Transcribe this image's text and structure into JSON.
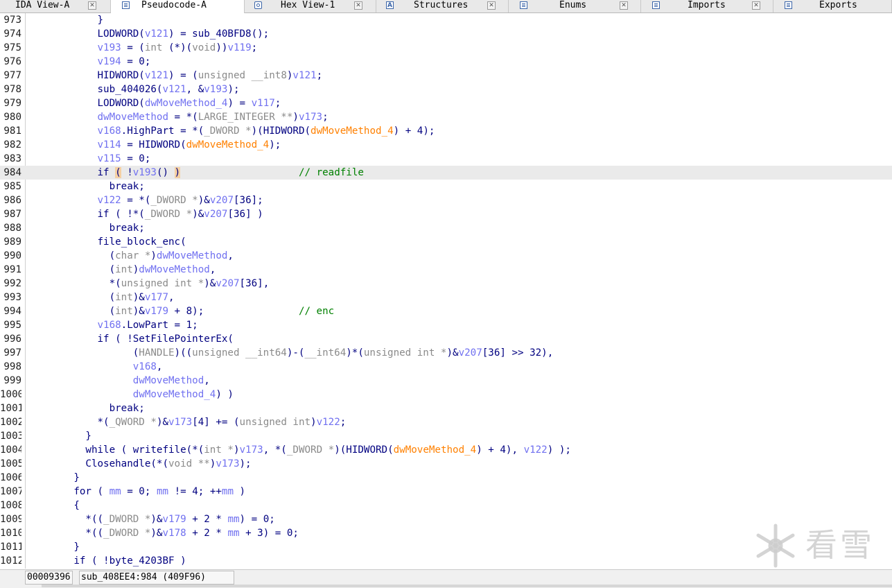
{
  "colors": {
    "keyword": "#000080",
    "variable": "#7070f0",
    "cast": "#8a8a8a",
    "argument": "#ff8000",
    "comment": "#008000",
    "highlight_line": "#eaeaea",
    "paren_match": "#f5d0a3"
  },
  "tabs": [
    {
      "label": "IDA View-A",
      "icon": "doc-icon",
      "active": false
    },
    {
      "label": "Pseudocode-A",
      "icon": "doc-icon",
      "active": true
    },
    {
      "label": "Hex View-1",
      "icon": "hex-icon",
      "active": false
    },
    {
      "label": "Structures",
      "icon": "struct-icon",
      "active": false
    },
    {
      "label": "Enums",
      "icon": "list-icon",
      "active": false
    },
    {
      "label": "Imports",
      "icon": "import-icon",
      "active": false
    },
    {
      "label": "Exports",
      "icon": "export-icon",
      "active": false
    }
  ],
  "tab_close_glyph": "✕",
  "code_lines": [
    {
      "num": "973",
      "tokens": [
        [
          "k",
          "            }"
        ]
      ]
    },
    {
      "num": "974",
      "tokens": [
        [
          "k",
          "            LODWORD("
        ],
        [
          "v",
          "v121"
        ],
        [
          "k",
          ") = sub_40BFD8();"
        ]
      ]
    },
    {
      "num": "975",
      "tokens": [
        [
          "k",
          "            "
        ],
        [
          "v",
          "v193"
        ],
        [
          "k",
          " = ("
        ],
        [
          "c",
          "int"
        ],
        [
          "k",
          " (*)("
        ],
        [
          "c",
          "void"
        ],
        [
          "k",
          "))"
        ],
        [
          "v",
          "v119"
        ],
        [
          "k",
          ";"
        ]
      ]
    },
    {
      "num": "976",
      "tokens": [
        [
          "k",
          "            "
        ],
        [
          "v",
          "v194"
        ],
        [
          "k",
          " = 0;"
        ]
      ]
    },
    {
      "num": "977",
      "tokens": [
        [
          "k",
          "            HIDWORD("
        ],
        [
          "v",
          "v121"
        ],
        [
          "k",
          ") = ("
        ],
        [
          "c",
          "unsigned __int8"
        ],
        [
          "k",
          ")"
        ],
        [
          "v",
          "v121"
        ],
        [
          "k",
          ";"
        ]
      ]
    },
    {
      "num": "978",
      "tokens": [
        [
          "k",
          "            sub_404026("
        ],
        [
          "v",
          "v121"
        ],
        [
          "k",
          ", &"
        ],
        [
          "v",
          "v193"
        ],
        [
          "k",
          ");"
        ]
      ]
    },
    {
      "num": "979",
      "tokens": [
        [
          "k",
          "            LODWORD("
        ],
        [
          "v",
          "dwMoveMethod_4"
        ],
        [
          "k",
          ") = "
        ],
        [
          "v",
          "v117"
        ],
        [
          "k",
          ";"
        ]
      ]
    },
    {
      "num": "980",
      "tokens": [
        [
          "k",
          "            "
        ],
        [
          "v",
          "dwMoveMethod"
        ],
        [
          "k",
          " = *("
        ],
        [
          "c",
          "LARGE_INTEGER **"
        ],
        [
          "k",
          ")"
        ],
        [
          "v",
          "v173"
        ],
        [
          "k",
          ";"
        ]
      ]
    },
    {
      "num": "981",
      "tokens": [
        [
          "k",
          "            "
        ],
        [
          "v",
          "v168"
        ],
        [
          "k",
          ".HighPart = *("
        ],
        [
          "c",
          "_DWORD *"
        ],
        [
          "k",
          ")(HIDWORD("
        ],
        [
          "a",
          "dwMoveMethod_4"
        ],
        [
          "k",
          ") + 4);"
        ]
      ]
    },
    {
      "num": "982",
      "tokens": [
        [
          "k",
          "            "
        ],
        [
          "v",
          "v114"
        ],
        [
          "k",
          " = HIDWORD("
        ],
        [
          "a",
          "dwMoveMethod_4"
        ],
        [
          "k",
          ");"
        ]
      ]
    },
    {
      "num": "983",
      "tokens": [
        [
          "k",
          "            "
        ],
        [
          "v",
          "v115"
        ],
        [
          "k",
          " = 0;"
        ]
      ]
    },
    {
      "num": "984",
      "hl": true,
      "tokens": [
        [
          "k",
          "            if "
        ],
        [
          "p",
          "("
        ],
        [
          "k",
          " !"
        ],
        [
          "v",
          "v193"
        ],
        [
          "k",
          "() "
        ],
        [
          "p",
          ")"
        ],
        [
          "k",
          "                    "
        ],
        [
          "m",
          "// readfile"
        ]
      ]
    },
    {
      "num": "985",
      "tokens": [
        [
          "k",
          "              break;"
        ]
      ]
    },
    {
      "num": "986",
      "tokens": [
        [
          "k",
          "            "
        ],
        [
          "v",
          "v122"
        ],
        [
          "k",
          " = *("
        ],
        [
          "c",
          "_DWORD *"
        ],
        [
          "k",
          ")&"
        ],
        [
          "v",
          "v207"
        ],
        [
          "k",
          "[36];"
        ]
      ]
    },
    {
      "num": "987",
      "tokens": [
        [
          "k",
          "            if ( !*("
        ],
        [
          "c",
          "_DWORD *"
        ],
        [
          "k",
          ")&"
        ],
        [
          "v",
          "v207"
        ],
        [
          "k",
          "[36] )"
        ]
      ]
    },
    {
      "num": "988",
      "tokens": [
        [
          "k",
          "              break;"
        ]
      ]
    },
    {
      "num": "989",
      "tokens": [
        [
          "k",
          "            file_block_enc("
        ]
      ]
    },
    {
      "num": "990",
      "tokens": [
        [
          "k",
          "              ("
        ],
        [
          "c",
          "char *"
        ],
        [
          "k",
          ")"
        ],
        [
          "v",
          "dwMoveMethod"
        ],
        [
          "k",
          ","
        ]
      ]
    },
    {
      "num": "991",
      "tokens": [
        [
          "k",
          "              ("
        ],
        [
          "c",
          "int"
        ],
        [
          "k",
          ")"
        ],
        [
          "v",
          "dwMoveMethod"
        ],
        [
          "k",
          ","
        ]
      ]
    },
    {
      "num": "992",
      "tokens": [
        [
          "k",
          "              *("
        ],
        [
          "c",
          "unsigned int *"
        ],
        [
          "k",
          ")&"
        ],
        [
          "v",
          "v207"
        ],
        [
          "k",
          "[36],"
        ]
      ]
    },
    {
      "num": "993",
      "tokens": [
        [
          "k",
          "              ("
        ],
        [
          "c",
          "int"
        ],
        [
          "k",
          ")&"
        ],
        [
          "v",
          "v177"
        ],
        [
          "k",
          ","
        ]
      ]
    },
    {
      "num": "994",
      "tokens": [
        [
          "k",
          "              ("
        ],
        [
          "c",
          "int"
        ],
        [
          "k",
          ")&"
        ],
        [
          "v",
          "v179"
        ],
        [
          "k",
          " + 8);                "
        ],
        [
          "m",
          "// enc"
        ]
      ]
    },
    {
      "num": "995",
      "tokens": [
        [
          "k",
          "            "
        ],
        [
          "v",
          "v168"
        ],
        [
          "k",
          ".LowPart = 1;"
        ]
      ]
    },
    {
      "num": "996",
      "tokens": [
        [
          "k",
          "            if ( !SetFilePointerEx("
        ]
      ]
    },
    {
      "num": "997",
      "tokens": [
        [
          "k",
          "                  ("
        ],
        [
          "c",
          "HANDLE"
        ],
        [
          "k",
          ")(("
        ],
        [
          "c",
          "unsigned __int64"
        ],
        [
          "k",
          ")-("
        ],
        [
          "c",
          "__int64"
        ],
        [
          "k",
          ")*("
        ],
        [
          "c",
          "unsigned int *"
        ],
        [
          "k",
          ")&"
        ],
        [
          "v",
          "v207"
        ],
        [
          "k",
          "[36] >> 32),"
        ]
      ]
    },
    {
      "num": "998",
      "tokens": [
        [
          "k",
          "                  "
        ],
        [
          "v",
          "v168"
        ],
        [
          "k",
          ","
        ]
      ]
    },
    {
      "num": "999",
      "tokens": [
        [
          "k",
          "                  "
        ],
        [
          "v",
          "dwMoveMethod"
        ],
        [
          "k",
          ","
        ]
      ]
    },
    {
      "num": "1000",
      "tokens": [
        [
          "k",
          "                  "
        ],
        [
          "v",
          "dwMoveMethod_4"
        ],
        [
          "k",
          ") )"
        ]
      ]
    },
    {
      "num": "1001",
      "tokens": [
        [
          "k",
          "              break;"
        ]
      ]
    },
    {
      "num": "1002",
      "tokens": [
        [
          "k",
          "            *("
        ],
        [
          "c",
          "_QWORD *"
        ],
        [
          "k",
          ")&"
        ],
        [
          "v",
          "v173"
        ],
        [
          "k",
          "[4] += ("
        ],
        [
          "c",
          "unsigned int"
        ],
        [
          "k",
          ")"
        ],
        [
          "v",
          "v122"
        ],
        [
          "k",
          ";"
        ]
      ]
    },
    {
      "num": "1003",
      "tokens": [
        [
          "k",
          "          }"
        ]
      ]
    },
    {
      "num": "1004",
      "tokens": [
        [
          "k",
          "          while ( writefile(*("
        ],
        [
          "c",
          "int *"
        ],
        [
          "k",
          ")"
        ],
        [
          "v",
          "v173"
        ],
        [
          "k",
          ", *("
        ],
        [
          "c",
          "_DWORD *"
        ],
        [
          "k",
          ")(HIDWORD("
        ],
        [
          "a",
          "dwMoveMethod_4"
        ],
        [
          "k",
          ") + 4), "
        ],
        [
          "v",
          "v122"
        ],
        [
          "k",
          ") );"
        ]
      ]
    },
    {
      "num": "1005",
      "tokens": [
        [
          "k",
          "          Closehandle(*("
        ],
        [
          "c",
          "void **"
        ],
        [
          "k",
          ")"
        ],
        [
          "v",
          "v173"
        ],
        [
          "k",
          ");"
        ]
      ]
    },
    {
      "num": "1006",
      "tokens": [
        [
          "k",
          "        }"
        ]
      ]
    },
    {
      "num": "1007",
      "tokens": [
        [
          "k",
          "        for ( "
        ],
        [
          "v",
          "mm"
        ],
        [
          "k",
          " = 0; "
        ],
        [
          "v",
          "mm"
        ],
        [
          "k",
          " != 4; ++"
        ],
        [
          "v",
          "mm"
        ],
        [
          "k",
          " )"
        ]
      ]
    },
    {
      "num": "1008",
      "tokens": [
        [
          "k",
          "        {"
        ]
      ]
    },
    {
      "num": "1009",
      "tokens": [
        [
          "k",
          "          *(("
        ],
        [
          "c",
          "_DWORD *"
        ],
        [
          "k",
          ")&"
        ],
        [
          "v",
          "v179"
        ],
        [
          "k",
          " + 2 * "
        ],
        [
          "v",
          "mm"
        ],
        [
          "k",
          ") = 0;"
        ]
      ]
    },
    {
      "num": "1010",
      "tokens": [
        [
          "k",
          "          *(("
        ],
        [
          "c",
          "_DWORD *"
        ],
        [
          "k",
          ")&"
        ],
        [
          "v",
          "v178"
        ],
        [
          "k",
          " + 2 * "
        ],
        [
          "v",
          "mm"
        ],
        [
          "k",
          " + 3) = 0;"
        ]
      ]
    },
    {
      "num": "1011",
      "tokens": [
        [
          "k",
          "        }"
        ]
      ]
    },
    {
      "num": "1012",
      "tokens": [
        [
          "k",
          "        if ( !byte_4203BF )"
        ]
      ]
    }
  ],
  "status": {
    "offset": "00009396",
    "location": "sub_408EE4:984 (409F96)"
  },
  "watermark": {
    "icon": "snowflake-icon",
    "text": "看雪"
  }
}
